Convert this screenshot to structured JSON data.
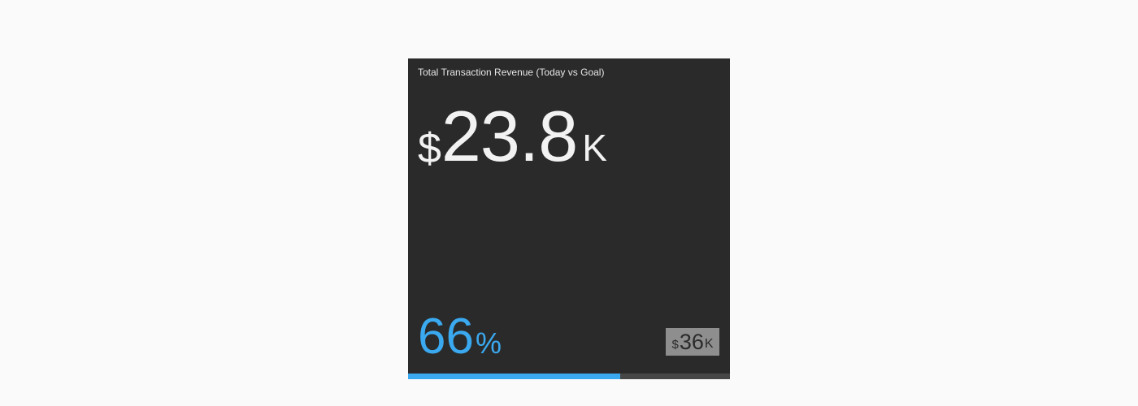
{
  "widget": {
    "title": "Total Transaction Revenue (Today vs Goal)",
    "value": {
      "currency": "$",
      "number": "23.8",
      "suffix": "K"
    },
    "percent": {
      "number": "66",
      "symbol": "%"
    },
    "goal": {
      "currency": "$",
      "number": "36",
      "suffix": "K"
    },
    "progress_fraction": 0.66
  },
  "colors": {
    "background": "#2a2a2a",
    "accent": "#3aa9f0",
    "track": "#474747",
    "badge": "#8e8e8e"
  }
}
